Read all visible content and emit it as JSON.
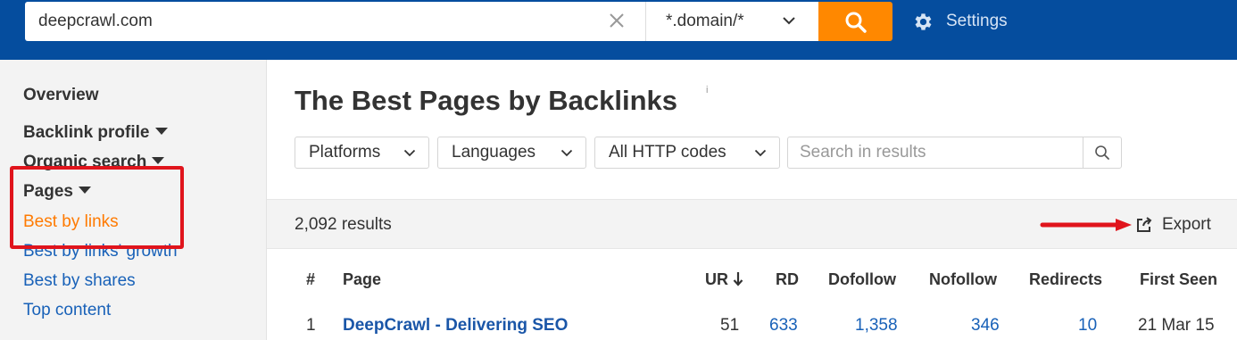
{
  "topbar": {
    "search_value": "deepcrawl.com",
    "mode_value": "*.domain/*",
    "settings_label": "Settings",
    "accent_color": "#ff8800",
    "brand_color": "#054d9e"
  },
  "sidebar": {
    "overview": "Overview",
    "backlink_profile": "Backlink profile",
    "organic_search": "Organic search",
    "pages": "Pages",
    "links": {
      "best_by_links": "Best by links",
      "best_by_links_growth": "Best by links' growth",
      "best_by_shares": "Best by shares",
      "top_content": "Top content"
    }
  },
  "main": {
    "title": "The Best Pages by Backlinks",
    "info_mark": "i",
    "filters": {
      "platforms": "Platforms",
      "languages": "Languages",
      "http_codes": "All HTTP codes"
    },
    "search_placeholder": "Search in results",
    "results_count": "2,092 results",
    "export_label": "Export",
    "table": {
      "headers": {
        "num": "#",
        "page": "Page",
        "ur": "UR",
        "rd": "RD",
        "dofollow": "Dofollow",
        "nofollow": "Nofollow",
        "redirects": "Redirects",
        "first_seen": "First Seen"
      },
      "rows": [
        {
          "num": "1",
          "page": "DeepCrawl - Delivering SEO",
          "ur": "51",
          "rd": "633",
          "dofollow": "1,358",
          "nofollow": "346",
          "redirects": "10",
          "first_seen": "21 Mar 15"
        }
      ]
    }
  }
}
